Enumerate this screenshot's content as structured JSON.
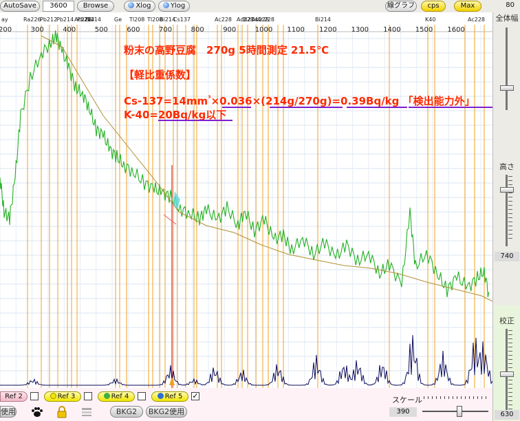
{
  "toolbar": {
    "autosave_label": "AutoSave",
    "time_value": "3600",
    "browse_label": "Browse",
    "xlog_label": "Xlog",
    "ylog_label": "Ylog",
    "line_graph_label": "線グラフ",
    "cps_label": "cps",
    "max_label": "Max",
    "right_value": "80"
  },
  "annotation": {
    "title": "粉末の高野豆腐　270g 5時間測定  21.5℃",
    "heading": "【軽比重係数】",
    "line1_prefix": "Cs-137=14mm",
    "line1_cube": "³",
    "line1_rest": "×0.036×(214g/270g)=0.39Bq/kg 「検出能力外」",
    "line2": "K-40=20Bq/kg以下"
  },
  "chart_data": {
    "type": "line",
    "title": "",
    "xlabel": "",
    "ylabel": "",
    "xlim": [
      0,
      1650
    ],
    "x_ticks": [
      "200",
      "300",
      "400",
      "500",
      "600",
      "700",
      "800",
      "900",
      "1000",
      "1100",
      "1200",
      "1300",
      "1400",
      "1500",
      "1600"
    ],
    "peak_labels": [
      "ay",
      "Ra226",
      "Pb212",
      "Pb214",
      "Ac228",
      "Pb214",
      "Bi214",
      "Ge",
      "Tl208",
      "Tl208",
      "Bi214",
      "Cs137",
      "Ac228",
      "Ac228",
      "Bi214",
      "Ac228",
      "Ac228",
      "Bi214",
      "K40",
      "Ac228"
    ],
    "series": [],
    "grid": true
  },
  "right_panel": {
    "overall_label": "全体幅",
    "height_label": "高さ",
    "height_value": "740",
    "calibration_label": "校正",
    "calibration_value": "630"
  },
  "refbar": {
    "ref2_label": "Ref 2",
    "ref3_label": "Ref 3",
    "ref4_label": "Ref 4",
    "ref5_label": "Ref 5",
    "ref3_checked": "",
    "ref4_checked": "",
    "ref5_checked": "✓",
    "use_label": "使用",
    "bkg2_label": "BKG2",
    "bkg2_use_label": "BKG2使用",
    "scale_label": "スケール",
    "scale_value": "390",
    "colors": {
      "ref3": "#f1e600",
      "ref4": "#3cb043",
      "ref5": "#2b6fd6"
    }
  }
}
